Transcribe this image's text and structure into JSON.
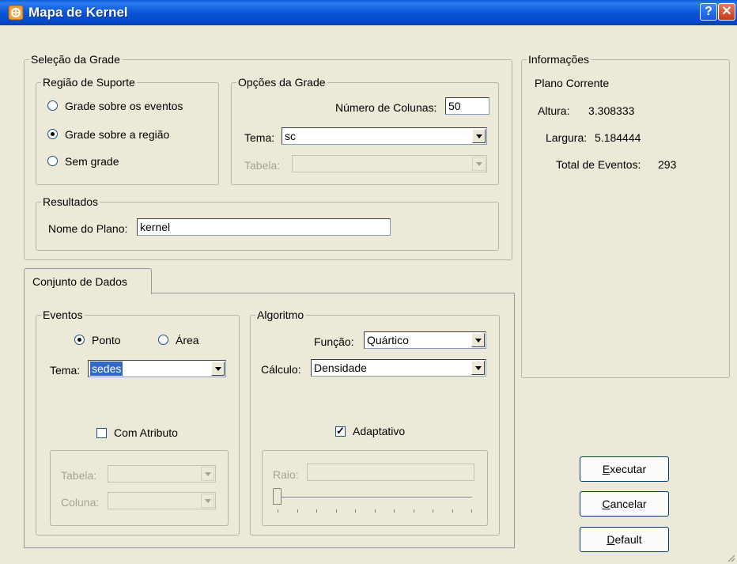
{
  "window": {
    "title": "Mapa de Kernel",
    "help_icon": "question-mark-icon",
    "close_icon": "close-icon"
  },
  "grid_selection": {
    "legend": "Seleção da Grade",
    "support_region": {
      "legend": "Região de Suporte",
      "options": [
        "Grade sobre os eventos",
        "Grade sobre a região",
        "Sem grade"
      ],
      "selected": "Grade sobre a região"
    },
    "grid_options": {
      "legend": "Opções da Grade",
      "columns_label": "Número de Colunas:",
      "columns_value": "50",
      "theme_label": "Tema:",
      "theme_value": "sc",
      "table_label": "Tabela:",
      "table_value": ""
    },
    "results": {
      "legend": "Resultados",
      "plane_name_label": "Nome do Plano:",
      "plane_name_value": "kernel"
    }
  },
  "info": {
    "legend": "Informações",
    "current_plane": "Plano Corrente",
    "height_label": "Altura:",
    "height_value": "3.308333",
    "width_label": "Largura:",
    "width_value": "5.184444",
    "total_events_label": "Total de Eventos:",
    "total_events_value": "293"
  },
  "tabs": [
    "Conjunto de Dados"
  ],
  "events": {
    "legend": "Eventos",
    "point_label": "Ponto",
    "area_label": "Área",
    "selected": "Ponto",
    "theme_label": "Tema:",
    "theme_value": "sedes",
    "with_attribute_label": "Com Atributo",
    "with_attribute_checked": false,
    "table_label": "Tabela:",
    "column_label": "Coluna:"
  },
  "algorithm": {
    "legend": "Algoritmo",
    "function_label": "Função:",
    "function_value": "Quártico",
    "calc_label": "Cálculo:",
    "calc_value": "Densidade",
    "adaptive_label": "Adaptativo",
    "adaptive_checked": true,
    "radius_label": "Raio:",
    "radius_value": "",
    "radius_slider_level": 0
  },
  "buttons": {
    "execute_prefix": "E",
    "execute_rest": "xecutar",
    "cancel_prefix": "C",
    "cancel_rest": "ancelar",
    "default_prefix": "D",
    "default_rest": "efault"
  },
  "colors": {
    "titlebar": "#0a55d8",
    "dialog_bg": "#ece9d8",
    "selection": "#316ac5"
  }
}
